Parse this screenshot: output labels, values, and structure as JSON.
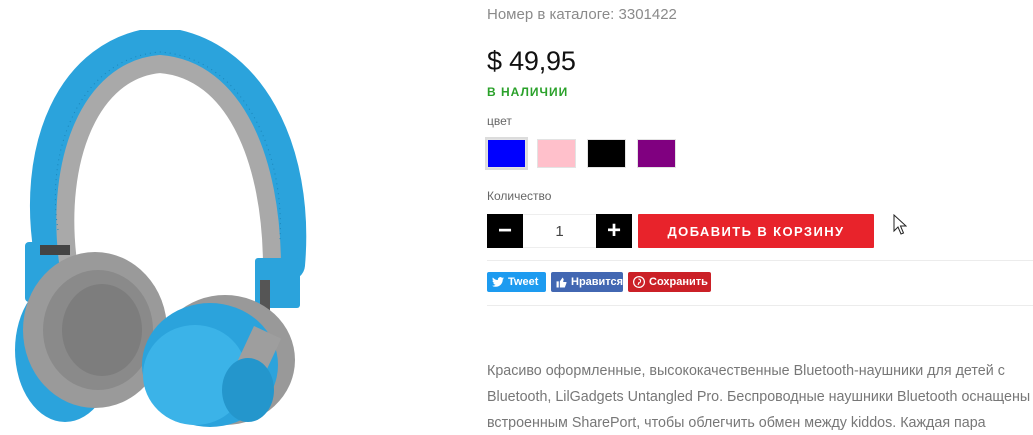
{
  "product": {
    "sku_label": "Номер в каталоге: 3301422",
    "price": "$ 49,95",
    "stock_status": "В НАЛИЧИИ",
    "image_icon": "headphones-product-image"
  },
  "color": {
    "label": "цвет",
    "swatches": [
      {
        "name": "blue",
        "hex": "#0000ff",
        "selected": true
      },
      {
        "name": "pink",
        "hex": "#ffc0cb",
        "selected": false
      },
      {
        "name": "black",
        "hex": "#000000",
        "selected": false
      },
      {
        "name": "purple",
        "hex": "#800080",
        "selected": false
      }
    ]
  },
  "quantity": {
    "label": "Количество",
    "value": "1",
    "decrement_label": "−",
    "increment_label": "+"
  },
  "cart": {
    "add_label": "ДОБАВИТЬ В КОРЗИНУ"
  },
  "share": {
    "tweet_label": "Tweet",
    "like_label": "Нравится",
    "save_label": "Сохранить"
  },
  "description": "Красиво оформленные, высококачественные Bluetooth-наушники для детей с Bluetooth, LilGadgets Untangled Pro. Беспроводные наушники Bluetooth оснащены встроенным SharePort, чтобы облегчить обмен между kiddos. Каждая пара",
  "colors": {
    "accent": "#e8232b",
    "in_stock": "#2aa12a",
    "twitter": "#1d9bf0",
    "facebook": "#4267b2",
    "pinterest": "#cb2027"
  }
}
